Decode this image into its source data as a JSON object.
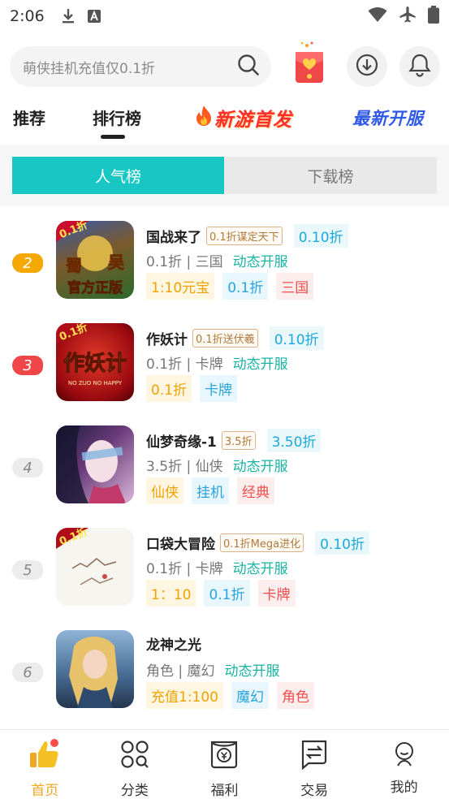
{
  "status_bar": {
    "time": "2:06"
  },
  "search": {
    "placeholder": "萌侠挂机充值仅0.1折"
  },
  "tabs": {
    "recommend": "推荐",
    "ranking": "排行榜",
    "new_games": "新游首发",
    "new_servers": "最新开服"
  },
  "segment": {
    "popular": "人气榜",
    "downloads": "下载榜"
  },
  "games": [
    {
      "rank": "2",
      "title": "国战来了",
      "promo": "0.1折谋定天下",
      "discount": "0.10折",
      "meta": "0.1折 | 三国",
      "status": "动态开服",
      "tags": [
        {
          "text": "1:10元宝",
          "color": "y"
        },
        {
          "text": "0.1折",
          "color": "b"
        },
        {
          "text": "三国",
          "color": "r"
        }
      ],
      "icon_text": [
        "0.1折",
        "蜀",
        "吴",
        "官方正版"
      ]
    },
    {
      "rank": "3",
      "title": "作妖计",
      "promo": "0.1折送伏羲",
      "discount": "0.10折",
      "meta": "0.1折 | 卡牌",
      "status": "动态开服",
      "tags": [
        {
          "text": "0.1折",
          "color": "y"
        },
        {
          "text": "卡牌",
          "color": "b"
        }
      ],
      "icon_text": [
        "0.1折",
        "作妖计",
        "NO ZUO NO HAPPY"
      ]
    },
    {
      "rank": "4",
      "title": "仙梦奇缘-1",
      "promo": "3.5折",
      "discount": "3.50折",
      "meta": "3.5折 | 仙侠",
      "status": "动态开服",
      "tags": [
        {
          "text": "仙侠",
          "color": "y"
        },
        {
          "text": "挂机",
          "color": "b"
        },
        {
          "text": "经典",
          "color": "r"
        }
      ],
      "icon_text": []
    },
    {
      "rank": "5",
      "title": "口袋大冒险",
      "promo": "0.1折Mega进化",
      "discount": "0.10折",
      "meta": "0.1折 | 卡牌",
      "status": "动态开服",
      "tags": [
        {
          "text": "1：10",
          "color": "y"
        },
        {
          "text": "0.1折",
          "color": "b"
        },
        {
          "text": "卡牌",
          "color": "r"
        }
      ],
      "icon_text": [
        "0.1折"
      ]
    },
    {
      "rank": "6",
      "title": "龙神之光",
      "promo": "",
      "discount": "",
      "meta": "角色 | 魔幻",
      "status": "动态开服",
      "tags": [
        {
          "text": "充值1:100",
          "color": "y"
        },
        {
          "text": "魔幻",
          "color": "b"
        },
        {
          "text": "角色",
          "color": "r"
        }
      ],
      "icon_text": []
    }
  ],
  "bottom_nav": {
    "home": "首页",
    "category": "分类",
    "welfare": "福利",
    "trade": "交易",
    "mine": "我的"
  },
  "colors": {
    "accent": "#18c7c3",
    "active_nav": "#f5a623",
    "rank2": "#f5a800",
    "rank3": "#ef4747"
  }
}
